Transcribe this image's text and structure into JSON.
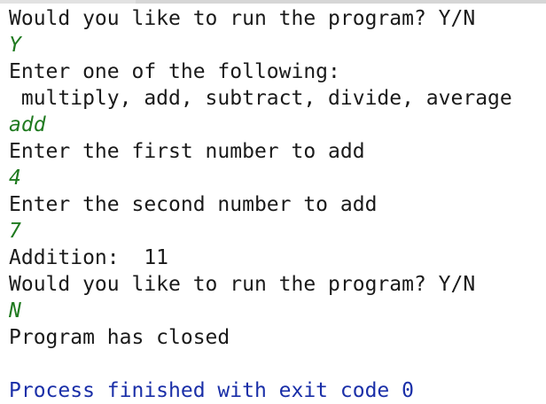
{
  "console": {
    "lines": [
      {
        "text": "Would you like to run the program? Y/N",
        "kind": "output"
      },
      {
        "text": "Y",
        "kind": "input"
      },
      {
        "text": "Enter one of the following:",
        "kind": "output"
      },
      {
        "text": " multiply, add, subtract, divide, average",
        "kind": "output"
      },
      {
        "text": "add",
        "kind": "input"
      },
      {
        "text": "Enter the first number to add",
        "kind": "output"
      },
      {
        "text": "4",
        "kind": "input"
      },
      {
        "text": "Enter the second number to add",
        "kind": "output"
      },
      {
        "text": "7",
        "kind": "input"
      },
      {
        "text": "Addition:  11",
        "kind": "output"
      },
      {
        "text": "Would you like to run the program? Y/N",
        "kind": "output"
      },
      {
        "text": "N",
        "kind": "input"
      },
      {
        "text": "Program has closed",
        "kind": "output"
      },
      {
        "text": "",
        "kind": "output"
      },
      {
        "text": "Process finished with exit code 0",
        "kind": "exit"
      }
    ]
  },
  "colors": {
    "output_text": "#1a1a1a",
    "input_text": "#1f7a1f",
    "exit_text": "#1a2fa8",
    "background": "#ffffff"
  }
}
